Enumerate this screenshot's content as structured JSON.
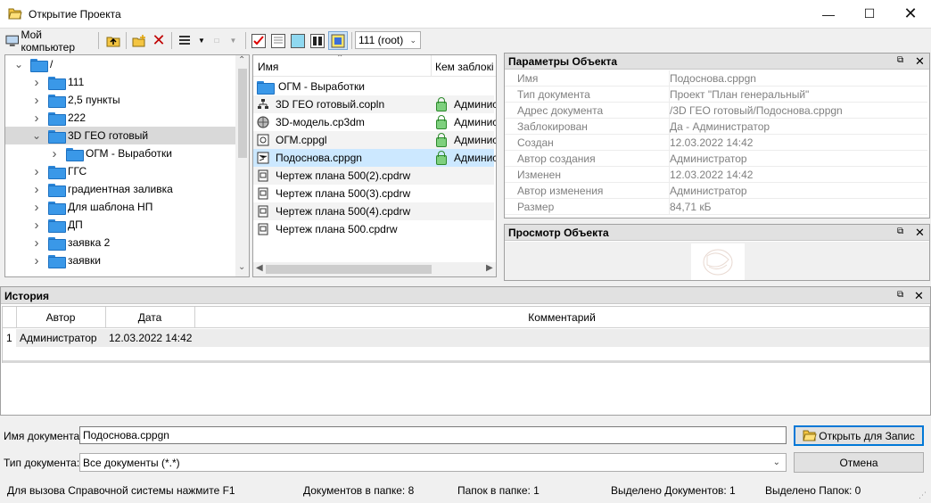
{
  "window": {
    "title": "Открытие Проекта"
  },
  "toolbar": {
    "my_computer": "Мой компьютер",
    "project_combo": "111 (root)"
  },
  "tree": {
    "root": "/",
    "items": [
      {
        "label": "111",
        "level": 1,
        "expanded": false,
        "selected": false
      },
      {
        "label": "2,5 пункты",
        "level": 1,
        "expanded": false,
        "selected": false
      },
      {
        "label": "222",
        "level": 1,
        "expanded": false,
        "selected": false
      },
      {
        "label": "3D ГЕО готовый",
        "level": 1,
        "expanded": true,
        "selected": true
      },
      {
        "label": "ОГМ - Выработки",
        "level": 2,
        "expanded": false,
        "selected": false
      },
      {
        "label": "ГГС",
        "level": 1,
        "expanded": false,
        "selected": false
      },
      {
        "label": "градиентная заливка",
        "level": 1,
        "expanded": false,
        "selected": false
      },
      {
        "label": "Для шаблона НП",
        "level": 1,
        "expanded": false,
        "selected": false
      },
      {
        "label": "ДП",
        "level": 1,
        "expanded": false,
        "selected": false
      },
      {
        "label": "заявка 2",
        "level": 1,
        "expanded": false,
        "selected": false
      },
      {
        "label": "заявки",
        "level": 1,
        "expanded": false,
        "selected": false
      }
    ]
  },
  "files": {
    "col_name": "Имя",
    "col_locked": "Кем заблокі",
    "rows": [
      {
        "name": "ОГМ - Выработки",
        "icon": "folder-icon",
        "locked": ""
      },
      {
        "name": "3D ГЕО готовый.copln",
        "icon": "network-icon",
        "locked": "Админис"
      },
      {
        "name": "3D-модель.cp3dm",
        "icon": "sphere-icon",
        "locked": "Админис"
      },
      {
        "name": "ОГМ.cppgl",
        "icon": "doc-icon",
        "locked": "Админис"
      },
      {
        "name": "Подоснова.cppgn",
        "icon": "plan-icon",
        "locked": "Админис"
      },
      {
        "name": "Чертеж плана 500(2).cpdrw",
        "icon": "drawing-icon",
        "locked": ""
      },
      {
        "name": "Чертеж плана 500(3).cpdrw",
        "icon": "drawing-icon",
        "locked": ""
      },
      {
        "name": "Чертеж плана 500(4).cpdrw",
        "icon": "drawing-icon",
        "locked": ""
      },
      {
        "name": "Чертеж плана 500.cpdrw",
        "icon": "drawing-icon",
        "locked": ""
      }
    ],
    "selected_index": 4
  },
  "params": {
    "title": "Параметры Объекта",
    "rows": [
      {
        "k": "Имя",
        "v": "Подоснова.cppgn"
      },
      {
        "k": "Тип документа",
        "v": "Проект \"План генеральный\""
      },
      {
        "k": "Адрес документа",
        "v": "/3D ГЕО готовый/Подоснова.cppgn"
      },
      {
        "k": "Заблокирован",
        "v": "Да - Администратор"
      },
      {
        "k": "Создан",
        "v": "12.03.2022 14:42"
      },
      {
        "k": "Автор создания",
        "v": "Администратор"
      },
      {
        "k": "Изменен",
        "v": "12.03.2022 14:42"
      },
      {
        "k": "Автор изменения",
        "v": "Администратор"
      },
      {
        "k": "Размер",
        "v": "84,71 кБ"
      }
    ]
  },
  "preview": {
    "title": "Просмотр Объекта"
  },
  "history": {
    "title": "История",
    "col_author": "Автор",
    "col_date": "Дата",
    "col_comment": "Комментарий",
    "rows": [
      {
        "n": "1",
        "author": "Администратор",
        "date": "12.03.2022 14:42",
        "comment": ""
      }
    ]
  },
  "bottom": {
    "docname_label": "Имя документа:",
    "docname_value": "Подоснова.cppgn",
    "doctype_label": "Тип документа:",
    "doctype_value": "Все документы (*.*)",
    "open_button": "Открыть для Запис",
    "cancel_button": "Отмена"
  },
  "status": {
    "help": "Для вызова Справочной системы нажмите F1",
    "docs_in_folder": "Документов в папке: 8",
    "folders_in_folder": "Папок в папке: 1",
    "selected_docs": "Выделено Документов: 1",
    "selected_folders": "Выделено Папок: 0"
  }
}
